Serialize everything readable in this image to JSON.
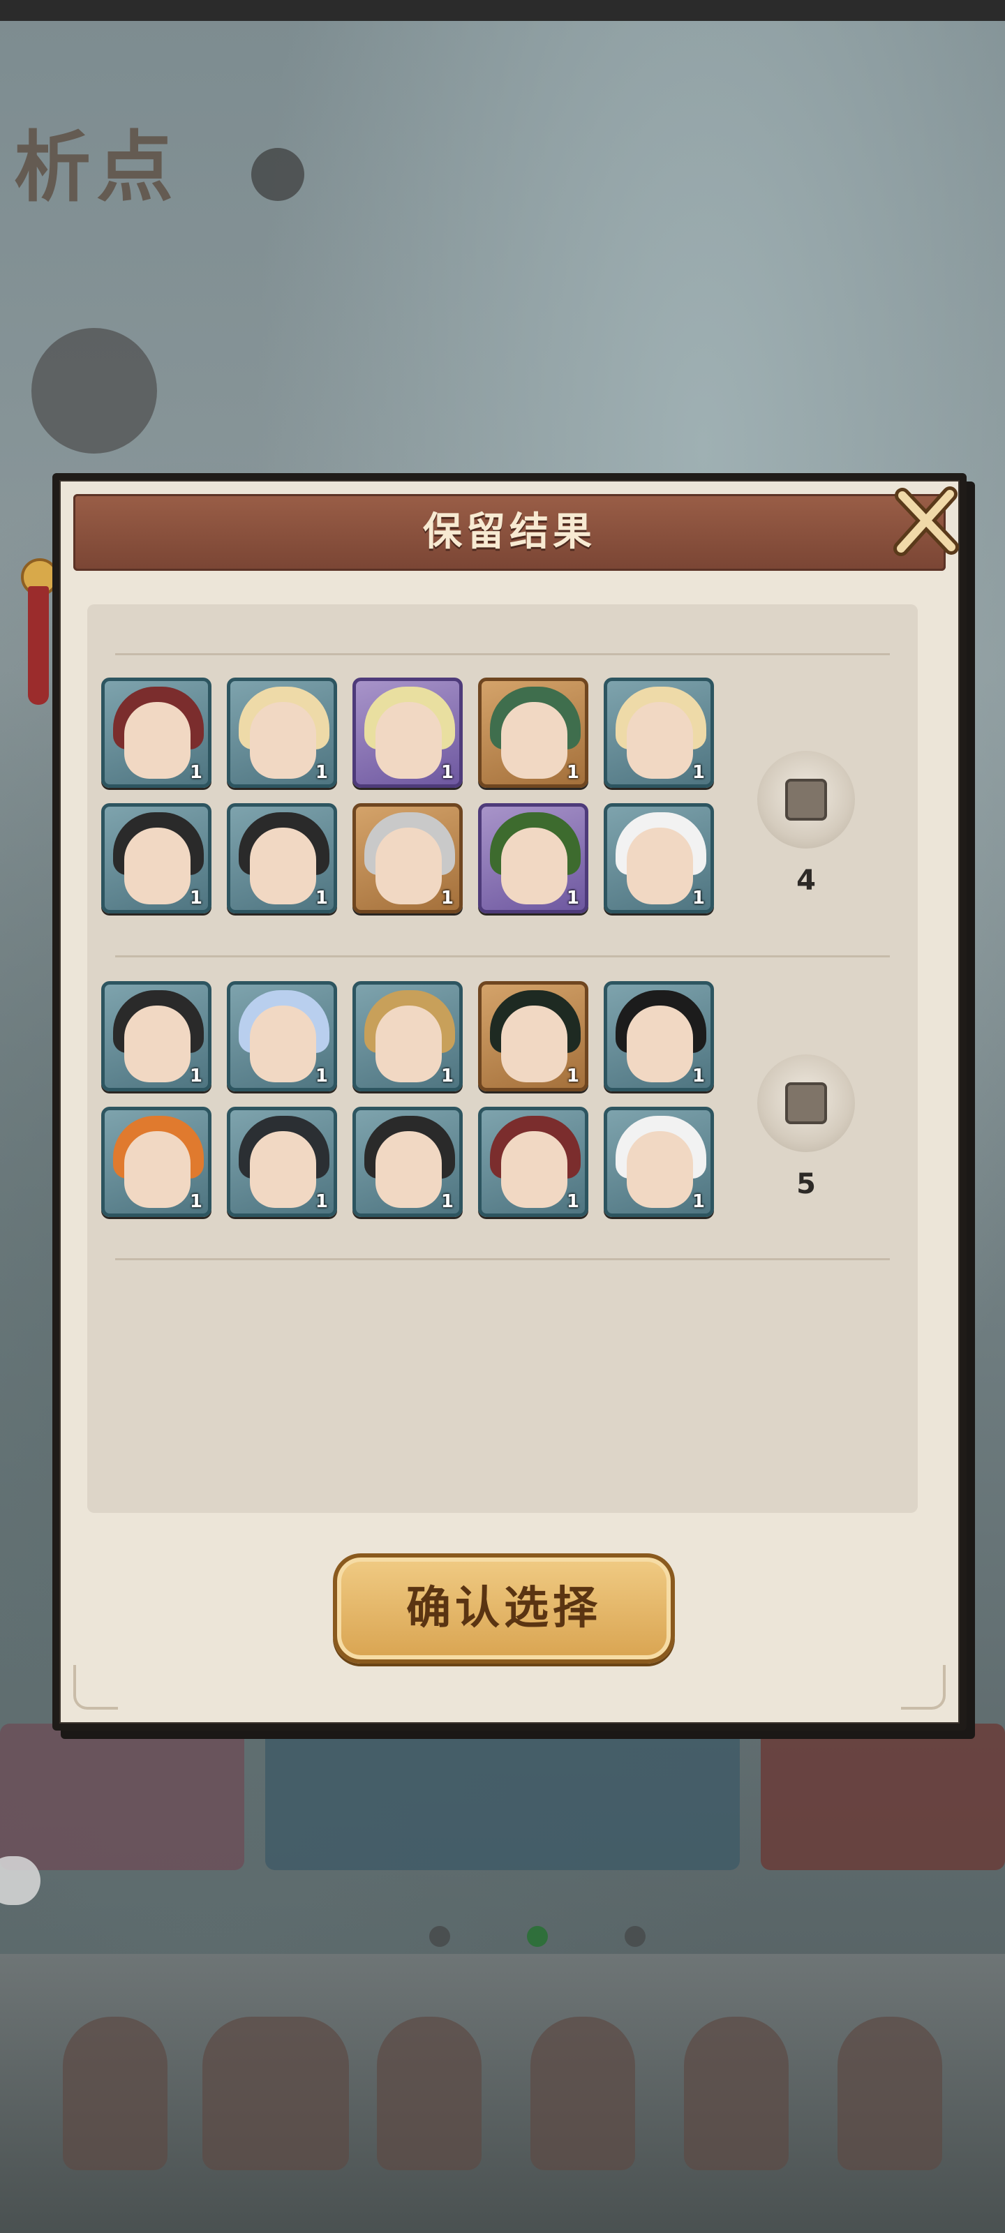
{
  "dialog": {
    "title": "保留结果",
    "confirm_label": "确认选择"
  },
  "groups": [
    {
      "count": "4",
      "rows": [
        [
          {
            "frame": "blue",
            "hair": "#7b2d2d",
            "count": "1"
          },
          {
            "frame": "blue",
            "hair": "#eedaa8",
            "count": "1"
          },
          {
            "frame": "purple",
            "hair": "#e9dfa0",
            "count": "1"
          },
          {
            "frame": "orange",
            "hair": "#3f6e4d",
            "count": "1"
          },
          {
            "frame": "blue",
            "hair": "#eedaa8",
            "count": "1"
          }
        ],
        [
          {
            "frame": "blue",
            "hair": "#2a2a2a",
            "count": "1"
          },
          {
            "frame": "blue",
            "hair": "#2a2a2a",
            "count": "1"
          },
          {
            "frame": "orange",
            "hair": "#c9c9c9",
            "count": "1"
          },
          {
            "frame": "purple",
            "hair": "#3d6b2e",
            "count": "1"
          },
          {
            "frame": "blue",
            "hair": "#f2f2f2",
            "count": "1"
          }
        ]
      ]
    },
    {
      "count": "5",
      "rows": [
        [
          {
            "frame": "blue",
            "hair": "#2a2a2a",
            "count": "1"
          },
          {
            "frame": "blue",
            "hair": "#b9cfee",
            "count": "1"
          },
          {
            "frame": "blue",
            "hair": "#c8a05a",
            "count": "1"
          },
          {
            "frame": "orange",
            "hair": "#1e2a22",
            "count": "1"
          },
          {
            "frame": "blue",
            "hair": "#1c1c1c",
            "count": "1"
          }
        ],
        [
          {
            "frame": "blue",
            "hair": "#e07a2e",
            "count": "1"
          },
          {
            "frame": "blue",
            "hair": "#2b2f33",
            "count": "1"
          },
          {
            "frame": "blue",
            "hair": "#2a2a2a",
            "count": "1"
          },
          {
            "frame": "blue",
            "hair": "#7b2d2d",
            "count": "1"
          },
          {
            "frame": "blue",
            "hair": "#f2f2f2",
            "count": "1"
          }
        ]
      ]
    }
  ],
  "colors": {
    "header": "#8a5240",
    "panel": "#ece5d8",
    "confirm": "#e2b366"
  }
}
